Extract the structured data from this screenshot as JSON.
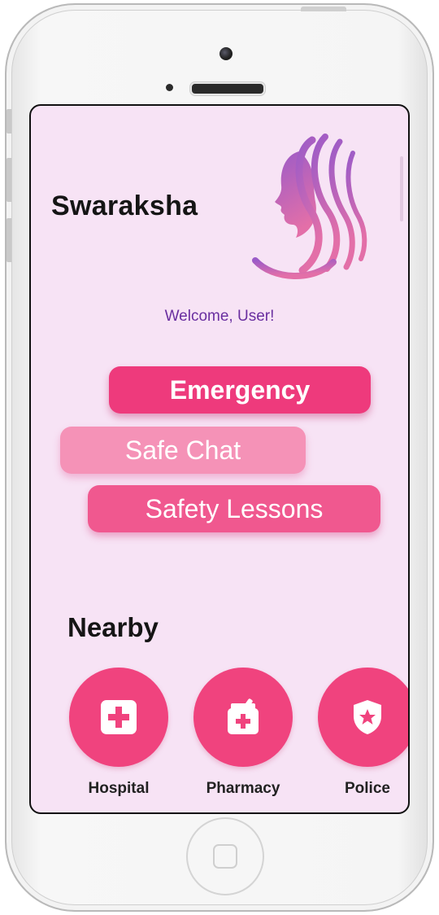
{
  "app": {
    "title": "Swaraksha",
    "welcome": "Welcome, User!"
  },
  "actions": {
    "emergency": "Emergency",
    "safe_chat": "Safe Chat",
    "safety_lessons": "Safety Lessons"
  },
  "nearby": {
    "title": "Nearby",
    "items": [
      {
        "label": "Hospital",
        "icon": "hospital-cross-icon"
      },
      {
        "label": "Pharmacy",
        "icon": "pharmacy-mortar-icon"
      },
      {
        "label": "Police",
        "icon": "police-shield-icon"
      }
    ]
  },
  "colors": {
    "background": "#f7e3f5",
    "accent": "#ee3a7c",
    "welcome_text": "#6a2fa0",
    "logo_purple": "#9b5bc8",
    "logo_pink": "#e36fa8"
  }
}
